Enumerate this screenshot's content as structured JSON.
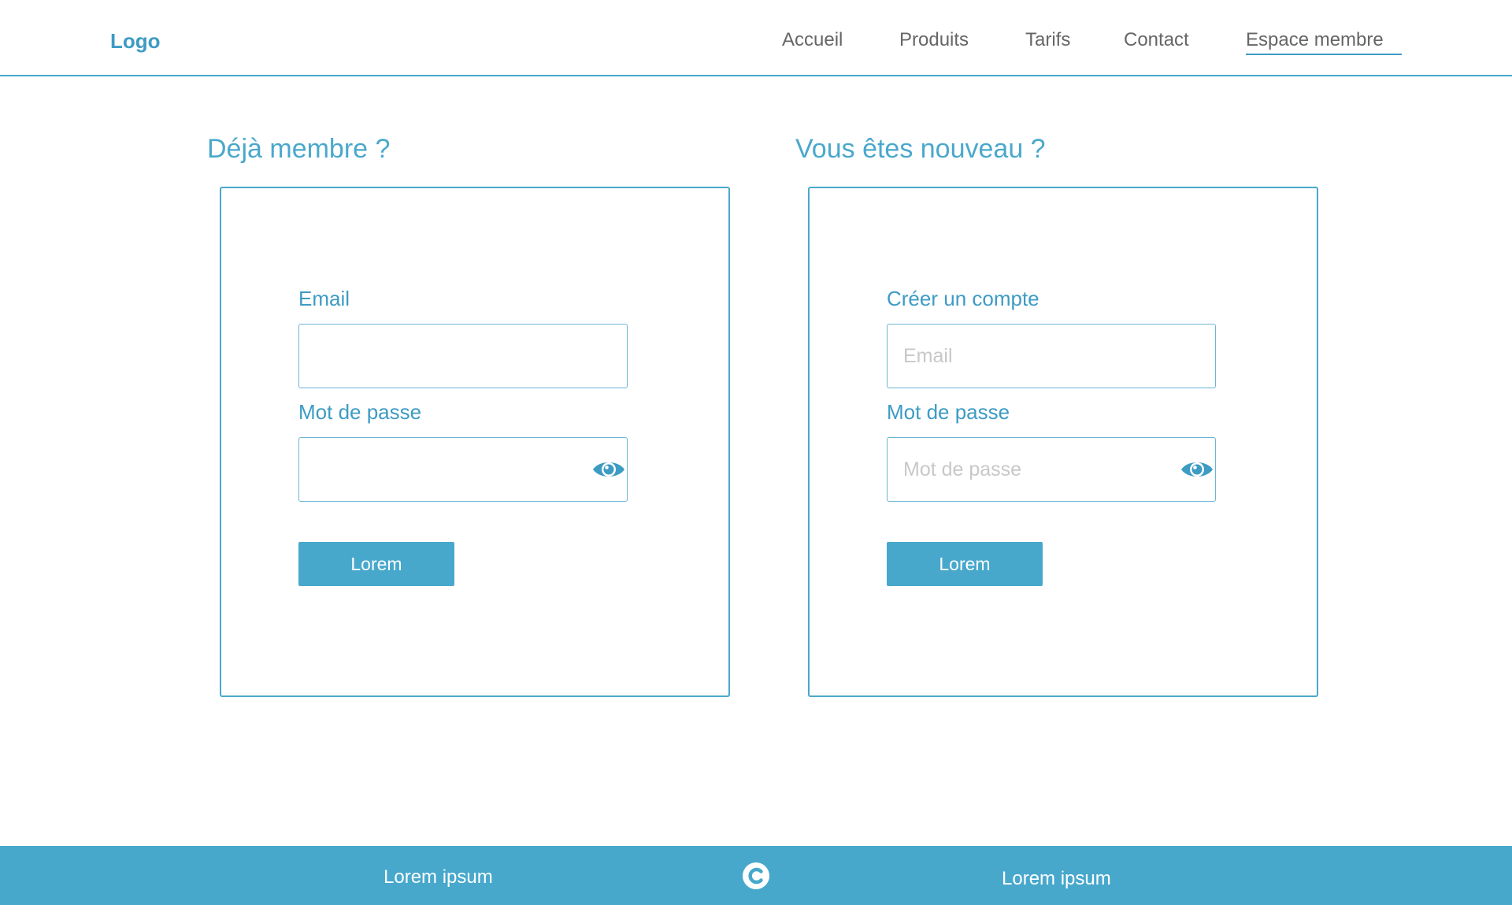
{
  "header": {
    "logo": "Logo",
    "nav": [
      "Accueil",
      "Produits",
      "Tarifs",
      "Contact",
      "Espace membre"
    ],
    "active_nav": "Espace membre"
  },
  "login": {
    "title": "Déjà membre ?",
    "email_label": "Email",
    "email_value": "",
    "password_label": "Mot de passe",
    "password_value": "",
    "button": "Lorem"
  },
  "signup": {
    "title": "Vous êtes nouveau ?",
    "email_label": "Créer un compte",
    "email_placeholder": "Email",
    "password_label": "Mot de passe",
    "password_placeholder": "Mot de passe",
    "button": "Lorem"
  },
  "footer": {
    "left": "Lorem ipsum",
    "right": "Lorem ipsum",
    "icon": "copyright-icon"
  },
  "colors": {
    "accent": "#47a8cc",
    "nav_text": "#666666",
    "placeholder": "#c8c8c8"
  }
}
